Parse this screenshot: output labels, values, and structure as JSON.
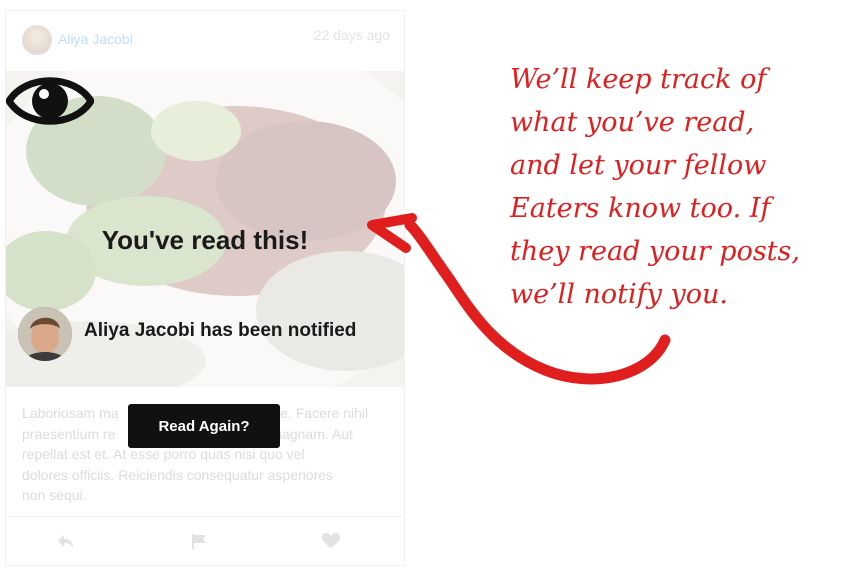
{
  "post": {
    "author": "Aliya Jacobi",
    "timestamp": "22 days ago",
    "read_title": "You've read this!",
    "notified_text": "Aliya Jacobi has been notified",
    "body_lines": [
      "Laboriosam ma",
      "praesentium re",
      "repellat est et. At esse porro quas nisi quo vel",
      "dolores officiis. Reiciendis consequatur asperiores",
      "non sequi."
    ],
    "body_line1_right": "nte. Facere nihil",
    "body_line2_right": "magnam. Aut",
    "read_again_label": "Read Again?"
  },
  "footer": {
    "icons": [
      "reply-icon",
      "flag-icon",
      "heart-icon"
    ]
  },
  "annotation": {
    "lines": [
      "We’ll keep track of",
      "what you’ve read,",
      "and let your fellow",
      "Eaters know too. If",
      "they read your posts,",
      "we’ll notify you."
    ],
    "color": "#e01e1e"
  }
}
